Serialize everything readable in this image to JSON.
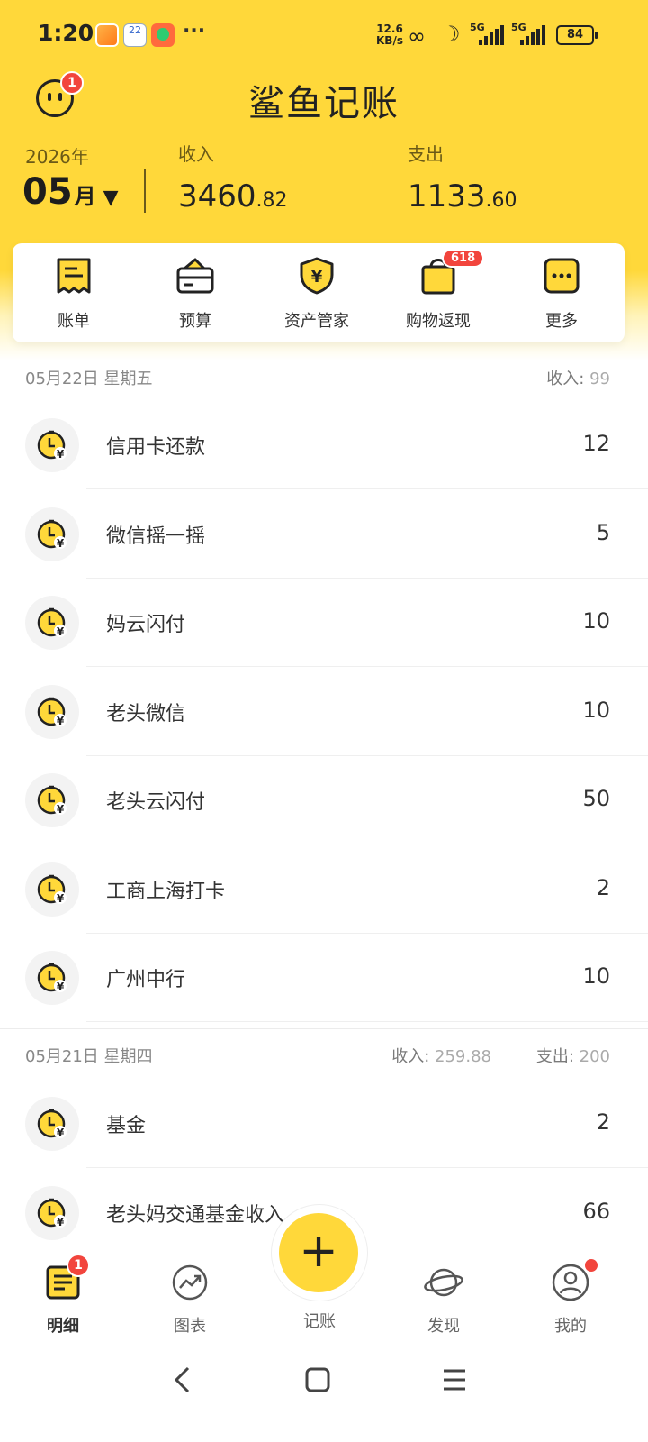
{
  "status_bar": {
    "time": "1:20",
    "calendar_day": "22",
    "more": "···",
    "net_speed_value": "12.6",
    "net_speed_unit": "KB/s",
    "sim1": "5G",
    "sim2": "5G",
    "battery": "84"
  },
  "header": {
    "title": "鲨鱼记账",
    "avatar_badge": "1"
  },
  "summary": {
    "year": "2026年",
    "month": "05",
    "month_unit": "月",
    "month_caret": "▼",
    "income_label": "收入",
    "income_int": "3460",
    "income_dec": ".82",
    "expense_label": "支出",
    "expense_int": "1133",
    "expense_dec": ".60"
  },
  "quick_menu": [
    {
      "label": "账单",
      "icon": "bill-icon"
    },
    {
      "label": "预算",
      "icon": "wallet-icon"
    },
    {
      "label": "资产管家",
      "icon": "shield-yen-icon"
    },
    {
      "label": "购物返现",
      "icon": "shopping-bag-icon",
      "badge": "618"
    },
    {
      "label": "更多",
      "icon": "more-icon"
    }
  ],
  "days": [
    {
      "date": "05月22日 星期五",
      "income_label": "收入:",
      "income_value": "99",
      "items": [
        {
          "name": "信用卡还款",
          "amount": "12"
        },
        {
          "name": "微信摇一摇",
          "amount": "5"
        },
        {
          "name": "妈云闪付",
          "amount": "10"
        },
        {
          "name": "老头微信",
          "amount": "10"
        },
        {
          "name": "老头云闪付",
          "amount": "50"
        },
        {
          "name": "工商上海打卡",
          "amount": "2"
        },
        {
          "name": "广州中行",
          "amount": "10"
        }
      ]
    },
    {
      "date": "05月21日 星期四",
      "income_label": "收入:",
      "income_value": "259.88",
      "expense_label": "支出:",
      "expense_value": "200",
      "items": [
        {
          "name": "基金",
          "amount": "2"
        },
        {
          "name": "老头妈交通基金收入",
          "amount": "66"
        }
      ]
    }
  ],
  "bottom_nav": {
    "items": [
      {
        "label": "明细",
        "icon": "list-icon",
        "badge": "1",
        "active": true
      },
      {
        "label": "图表",
        "icon": "chart-icon"
      },
      {
        "label": "记账",
        "icon": "plus-icon"
      },
      {
        "label": "发现",
        "icon": "planet-icon"
      },
      {
        "label": "我的",
        "icon": "profile-icon"
      }
    ],
    "fab_symbol": "+"
  },
  "system_nav": {
    "back": "‹",
    "home": "□",
    "menu": "≡"
  },
  "colors": {
    "accent": "#FFD83A",
    "badge": "#F2453D",
    "text": "#333333"
  }
}
